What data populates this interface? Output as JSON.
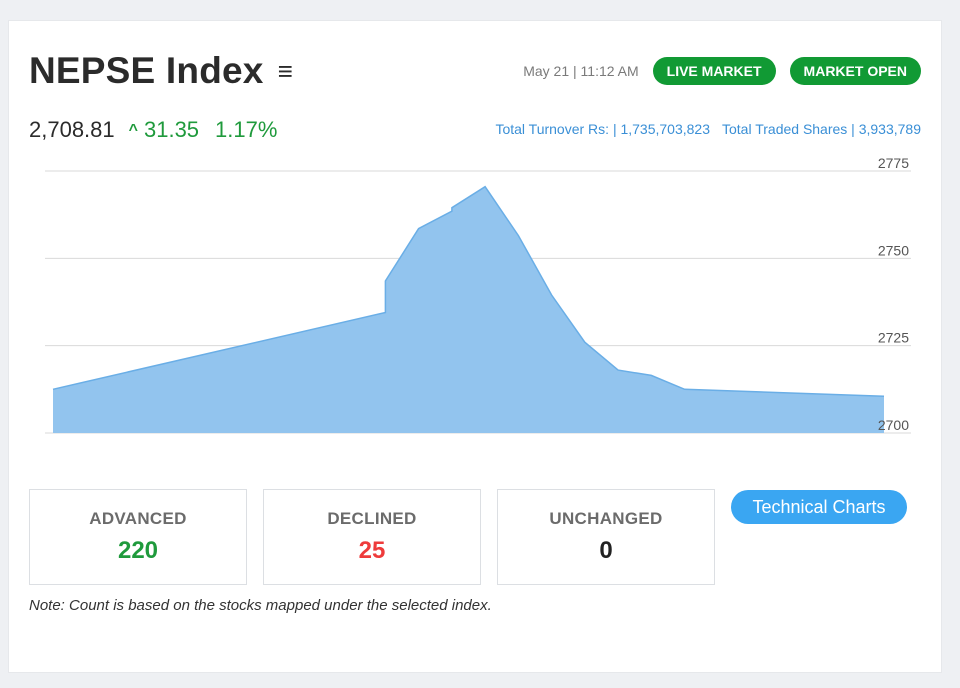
{
  "header": {
    "title": "NEPSE Index",
    "menu_icon": "menu-icon",
    "datetime": "May 21 | 11:12 AM",
    "live_market_label": "LIVE MARKET",
    "market_open_label": "MARKET OPEN",
    "pill_color": "#119a34"
  },
  "stats": {
    "index_value": "2,708.81",
    "arrow_icon": "chevron-up-icon",
    "arrow_glyph": "^",
    "change": "31.35",
    "change_percent": "1.17%",
    "positive_color": "#1f9a3c"
  },
  "turnover": {
    "total_turnover": "Total Turnover Rs: | 1,735,703,823",
    "total_traded_shares": "Total Traded Shares | 3,933,789",
    "link_color": "#3a8fd6"
  },
  "chart_data": {
    "type": "area",
    "title": "",
    "xlabel": "",
    "ylabel": "",
    "ylim": [
      2700,
      2775
    ],
    "yticks": [
      "2775",
      "2750",
      "2725",
      "2700"
    ],
    "grid": true,
    "fill_color": "#92c4ee",
    "line_color": "#6aaee6",
    "y_axis_position": "right",
    "values": [
      2712.5,
      2734.5,
      2743.5,
      2758.5,
      2763.5,
      2764.5,
      2770.5,
      2756.5,
      2739.5,
      2726.0,
      2718.0,
      2716.5,
      2712.5,
      2710.5
    ],
    "x": [
      0,
      0.4,
      0.4,
      0.44,
      0.48,
      0.48,
      0.52,
      0.56,
      0.6,
      0.64,
      0.68,
      0.72,
      0.76,
      1.0
    ]
  },
  "counts": {
    "advanced_label": "ADVANCED",
    "advanced_value": "220",
    "declined_label": "DECLINED",
    "declined_value": "25",
    "unchanged_label": "UNCHANGED",
    "unchanged_value": "0"
  },
  "technical_charts_label": "Technical Charts",
  "note": "Note: Count is based on the stocks mapped under the selected index."
}
